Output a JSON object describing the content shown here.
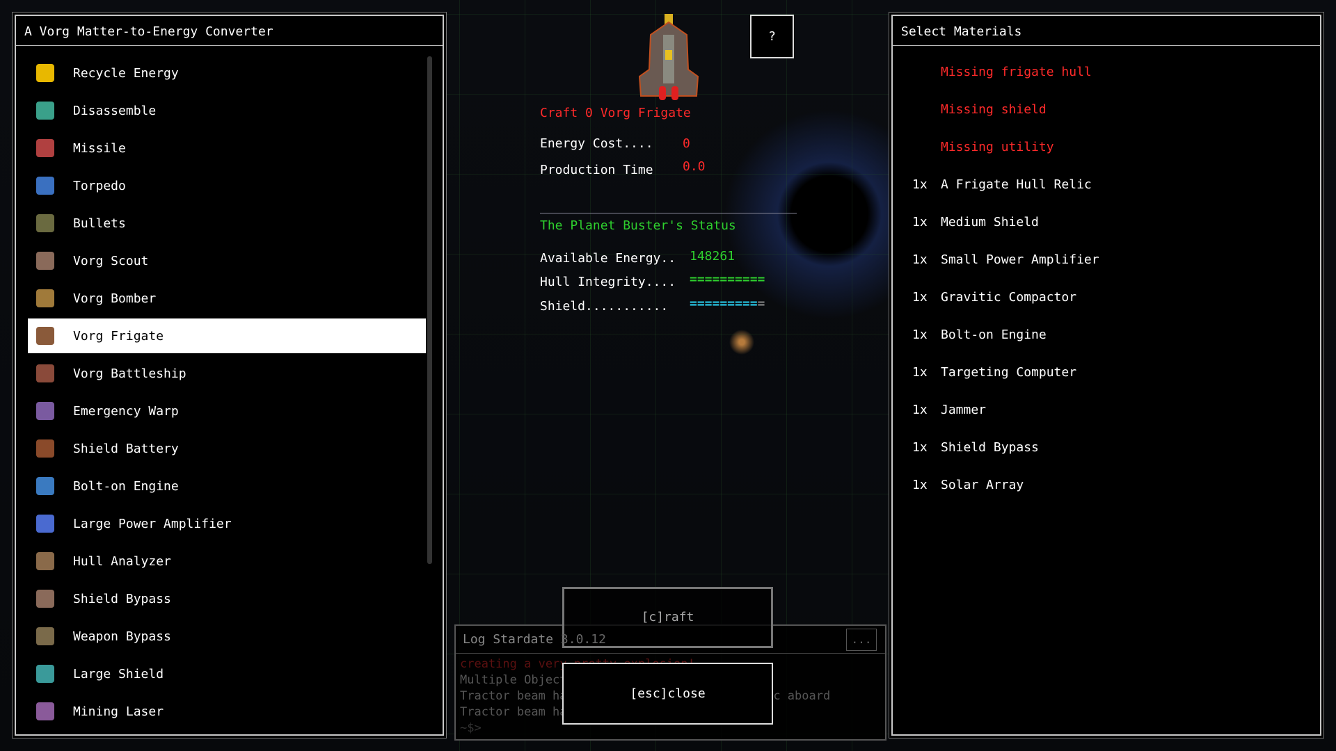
{
  "left_panel": {
    "title": "A Vorg Matter-to-Energy Converter",
    "selected_index": 7,
    "items": [
      {
        "label": "Recycle Energy",
        "icon": "recycle-energy-icon",
        "color": "#e8b800"
      },
      {
        "label": "Disassemble",
        "icon": "disassemble-icon",
        "color": "#3aa08a"
      },
      {
        "label": "Missile",
        "icon": "missile-icon",
        "color": "#b04040"
      },
      {
        "label": "Torpedo",
        "icon": "torpedo-icon",
        "color": "#3a70c0"
      },
      {
        "label": "Bullets",
        "icon": "bullets-icon",
        "color": "#6a6a40"
      },
      {
        "label": "Vorg Scout",
        "icon": "vorg-scout-icon",
        "color": "#8a6a5a"
      },
      {
        "label": "Vorg Bomber",
        "icon": "vorg-bomber-icon",
        "color": "#a07a3a"
      },
      {
        "label": "Vorg Frigate",
        "icon": "vorg-frigate-icon",
        "color": "#8a5a3a"
      },
      {
        "label": "Vorg Battleship",
        "icon": "vorg-battleship-icon",
        "color": "#8a4a3a"
      },
      {
        "label": "Emergency Warp",
        "icon": "emergency-warp-icon",
        "color": "#7a5aa0"
      },
      {
        "label": "Shield Battery",
        "icon": "shield-battery-icon",
        "color": "#8a4a2a"
      },
      {
        "label": "Bolt-on Engine",
        "icon": "bolt-on-engine-icon",
        "color": "#3a7ac0"
      },
      {
        "label": "Large Power Amplifier",
        "icon": "large-power-amplifier-icon",
        "color": "#4a6ad0"
      },
      {
        "label": "Hull Analyzer",
        "icon": "hull-analyzer-icon",
        "color": "#8a6a4a"
      },
      {
        "label": "Shield Bypass",
        "icon": "shield-bypass-icon",
        "color": "#8a6a5a"
      },
      {
        "label": "Weapon Bypass",
        "icon": "weapon-bypass-icon",
        "color": "#7a6a4a"
      },
      {
        "label": "Large Shield",
        "icon": "large-shield-icon",
        "color": "#3a9a9a"
      },
      {
        "label": "Mining Laser",
        "icon": "mining-laser-icon",
        "color": "#8a5a9a"
      }
    ]
  },
  "center": {
    "help_label": "?",
    "craft_title": "Craft 0 Vorg Frigate",
    "energy_cost_label": "Energy Cost....",
    "energy_cost_value": "0",
    "production_time_label": "Production Time",
    "production_time_value": "0.0",
    "status_title": "The Planet Buster's Status",
    "available_energy_label": "Available Energy..",
    "available_energy_value": "148261",
    "hull_label": "Hull Integrity....",
    "hull_bar": "==========",
    "hull_fraction": 1.0,
    "shield_label": "Shield...........",
    "shield_bar": "=========",
    "shield_bar_empty": "=",
    "shield_fraction": 0.9,
    "craft_button": "[c]raft",
    "close_button": "[esc]close",
    "colors": {
      "red": "#ff2a2a",
      "green": "#2ed02e",
      "cyan": "#2ad0f0"
    }
  },
  "log": {
    "title": "Log Stardate",
    "stardate": "3.0.12",
    "menu": "...",
    "lines": [
      "creating a very pretty explosion!",
      "Multiple Objects Detected",
      "Tractor beam has brought A Frigate Hull Relic aboard",
      "Tractor beam has brought Uranium aboard"
    ],
    "prompt": "~$>"
  },
  "right_panel": {
    "title": "Select Materials",
    "missing": [
      "Missing frigate hull",
      "Missing shield",
      "Missing utility"
    ],
    "materials": [
      {
        "qty": "1x",
        "name": "A Frigate Hull Relic"
      },
      {
        "qty": "1x",
        "name": "Medium Shield"
      },
      {
        "qty": "1x",
        "name": "Small Power Amplifier"
      },
      {
        "qty": "1x",
        "name": "Gravitic Compactor"
      },
      {
        "qty": "1x",
        "name": "Bolt-on Engine"
      },
      {
        "qty": "1x",
        "name": "Targeting Computer"
      },
      {
        "qty": "1x",
        "name": "Jammer"
      },
      {
        "qty": "1x",
        "name": "Shield Bypass"
      },
      {
        "qty": "1x",
        "name": "Solar Array"
      }
    ]
  }
}
